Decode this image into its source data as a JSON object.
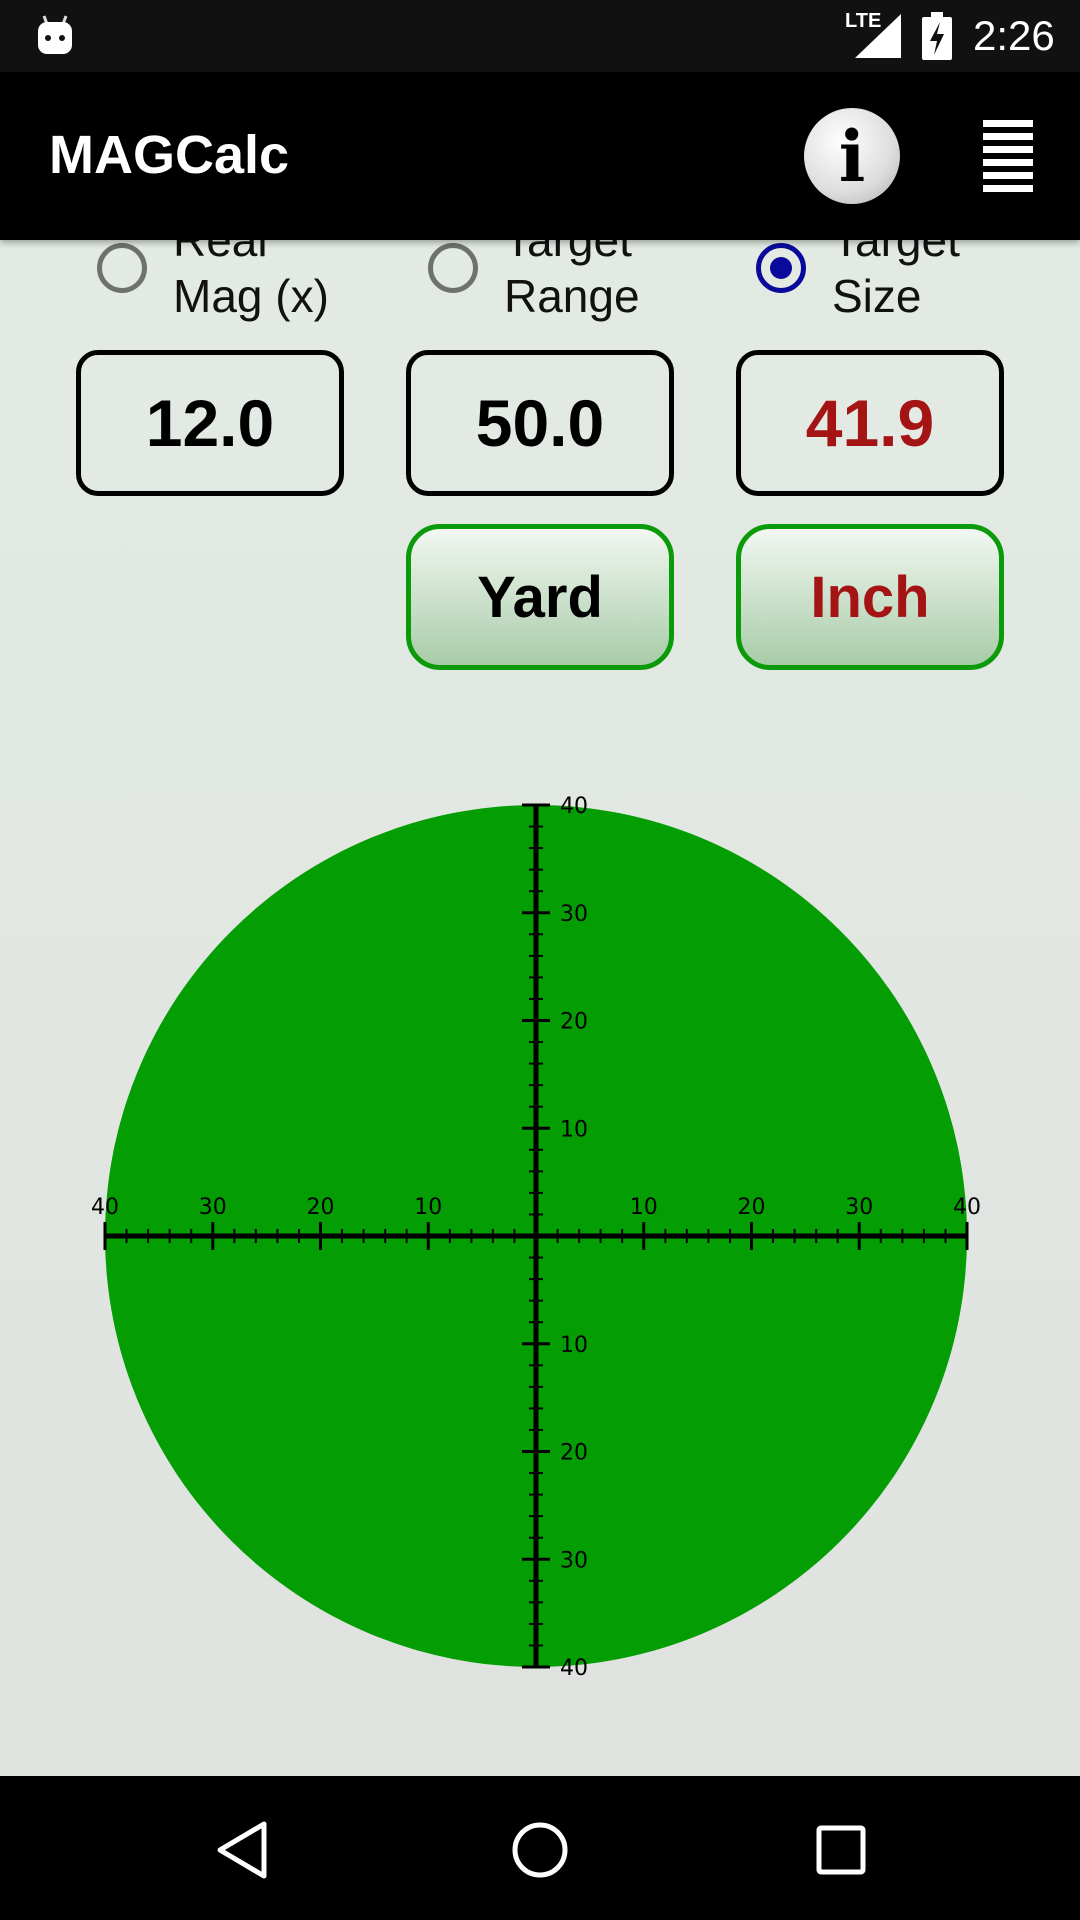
{
  "status_bar": {
    "time": "2:26",
    "network": "LTE",
    "icons": [
      "android-notification-icon",
      "lte-signal-icon",
      "battery-charging-icon"
    ]
  },
  "app_bar": {
    "title": "MAGCalc",
    "info_icon": "info-icon",
    "menu_icon": "menu-icon"
  },
  "modes": [
    {
      "label_line1": "Real",
      "label_line2": "Mag (x)",
      "selected": false
    },
    {
      "label_line1": "Target",
      "label_line2": "Range",
      "selected": false
    },
    {
      "label_line1": "Target",
      "label_line2": "Size",
      "selected": true
    }
  ],
  "fields": [
    {
      "value": "12.0"
    },
    {
      "value": "50.0"
    },
    {
      "value": "41.9",
      "color": "#a51414"
    }
  ],
  "unit_buttons": [
    {
      "label": "Yard"
    },
    {
      "label": "Inch",
      "color": "#a51414"
    }
  ],
  "reticle": {
    "fill": "#049e04",
    "range": 40,
    "major_step": 10,
    "minor_step": 2,
    "h_labels": [
      "40",
      "30",
      "20",
      "10",
      "10",
      "20",
      "30",
      "40"
    ],
    "v_labels": [
      "40",
      "30",
      "20",
      "10",
      "10",
      "20",
      "30",
      "40"
    ]
  },
  "nav_bar": {
    "icons": [
      "back-icon",
      "home-icon",
      "recents-icon"
    ]
  }
}
